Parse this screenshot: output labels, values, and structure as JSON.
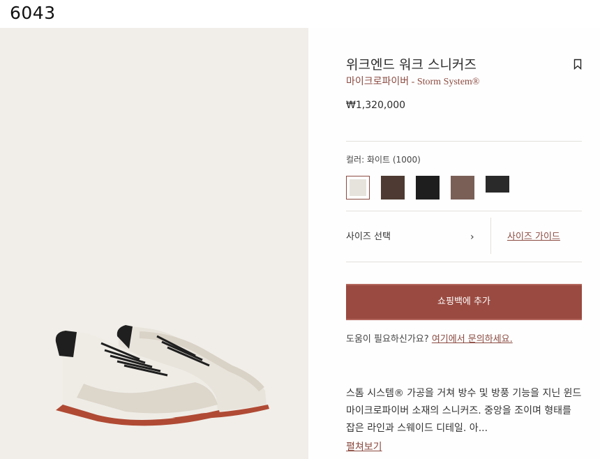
{
  "image_id": "6043",
  "product": {
    "title": "위크엔드 워크 스니커즈",
    "material": "마이크로파이버",
    "separator": " - ",
    "technology": "Storm System®",
    "price": "₩1,320,000",
    "bookmark_icon": "bookmark-icon"
  },
  "color": {
    "label": "컬러: 화이트 (1000)",
    "swatches": [
      {
        "name": "white",
        "hex": "#e6e3dc",
        "selected": true
      },
      {
        "name": "brown",
        "hex": "#4e3a32"
      },
      {
        "name": "black",
        "hex": "#1e1e1e"
      },
      {
        "name": "taupe",
        "hex": "#7a5f57"
      },
      {
        "name": "black-white",
        "hex": "#2a2a2a"
      }
    ]
  },
  "size": {
    "select_label": "사이즈 선택",
    "chevron": "›",
    "guide_label": "사이즈 가이드"
  },
  "cart": {
    "add_label": "쇼핑백에 추가"
  },
  "help": {
    "text": "도움이 필요하신가요? ",
    "link": "여기에서 문의하세요."
  },
  "description": {
    "text": "스톰 시스템® 가공을 거쳐 방수 및 방풍 기능을 지닌 윈드 마이크로파이버 소재의 스니커즈. 중앙을 조이며 형태를 잡은 라인과 스웨이드 디테일. 아...",
    "read_more": "펼쳐보기"
  },
  "colors": {
    "accent": "#9a4a40",
    "image_bg": "#f1eee9"
  }
}
